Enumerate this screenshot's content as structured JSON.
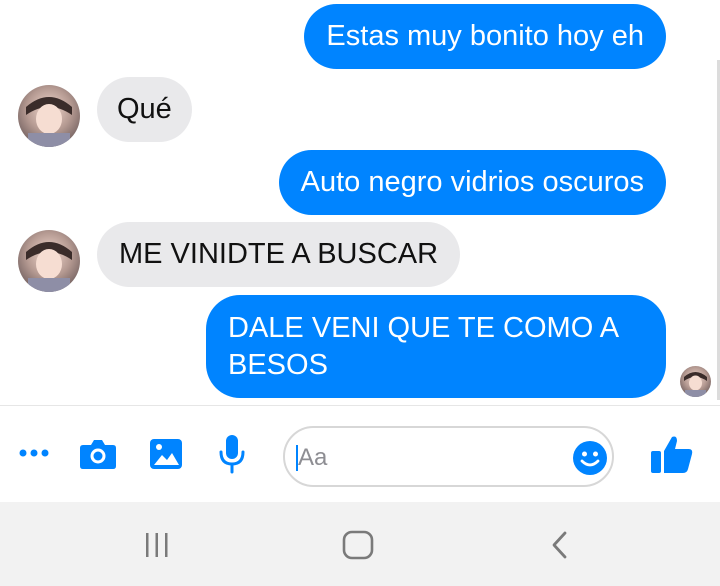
{
  "conversation": {
    "messages": [
      {
        "direction": "outgoing",
        "text": "Estas muy bonito hoy eh"
      },
      {
        "direction": "incoming",
        "text": "Qué"
      },
      {
        "direction": "outgoing",
        "text": "Auto negro vidrios oscuros"
      },
      {
        "direction": "incoming",
        "text": "ME VINIDTE A BUSCAR"
      },
      {
        "direction": "outgoing",
        "text": "DALE VENI QUE TE COMO A BESOS"
      }
    ]
  },
  "composer": {
    "placeholder": "Aa",
    "icons": [
      "more-icon",
      "camera-icon",
      "gallery-icon",
      "microphone-icon",
      "emoji-icon",
      "like-icon"
    ]
  },
  "colors": {
    "outgoing_bubble": "#0084ff",
    "incoming_bubble": "#e9e9eb",
    "accent": "#0084ff"
  },
  "navbar": {
    "icons": [
      "recent-apps-icon",
      "home-icon",
      "back-icon"
    ]
  }
}
